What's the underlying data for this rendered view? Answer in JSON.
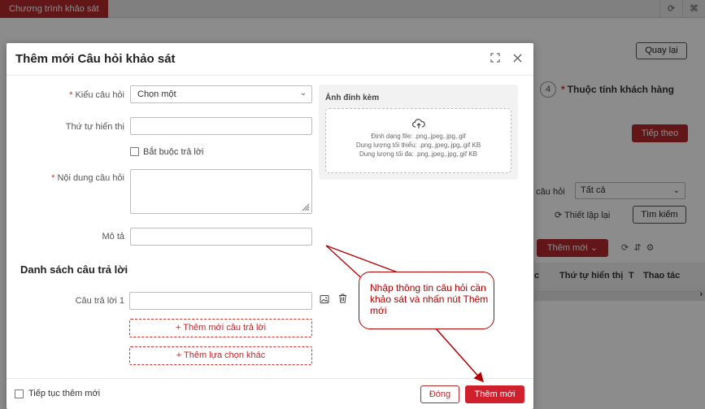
{
  "background": {
    "tab_label": "Chương trình khảo sát",
    "back_button": "Quay lại",
    "step_number": "4",
    "step_label": "Thuộc tính khách hàng",
    "next_button": "Tiếp theo",
    "filter_label_partial": "u câu hỏi",
    "filter_value": "Tất cả",
    "reset_label": "Thiết lập lại",
    "search_button": "Tìm kiếm",
    "add_button": "Thêm mới",
    "col_partial": "c",
    "col_order": "Thứ tự hiển thị",
    "col_marker": "T",
    "col_actions": "Thao tác"
  },
  "modal": {
    "title": "Thêm mới Câu hỏi khảo sát",
    "fields": {
      "question_type_label": "Kiểu câu hỏi",
      "question_type_value": "Chọn một",
      "display_order_label": "Thứ tự hiển thị",
      "display_order_value": "",
      "required_label": "Bắt buộc trả lời",
      "content_label": "Nội dung câu hỏi",
      "content_value": "",
      "description_label": "Mô tả",
      "description_value": ""
    },
    "attachment": {
      "title": "Ảnh đính kèm",
      "formats": "Định dạng file: .png,.jpeg,.jpg,.gif",
      "min_size": "Dung lượng tối thiểu: .png,.jpeg,.jpg,.gif KB",
      "max_size": "Dung lượng tối đa: .png,.jpeg,.jpg,.gif KB"
    },
    "answers": {
      "section_title": "Danh sách câu trả lời",
      "answer_1_label": "Câu trả lời 1",
      "answer_1_value": "",
      "add_answer": "+ Thêm mới câu trả lời",
      "add_other": "+ Thêm lựa chọn khác"
    },
    "footer": {
      "continue_label": "Tiếp tục thêm mới",
      "close_button": "Đóng",
      "submit_button": "Thêm mới"
    }
  },
  "annotation": {
    "callout_text": "Nhập thông tin câu hỏi cần khảo sát và nhấn nút Thêm mới"
  },
  "colors": {
    "brand_red": "#b3282d",
    "submit_red": "#d0202e",
    "annotation_red": "#b00000"
  }
}
